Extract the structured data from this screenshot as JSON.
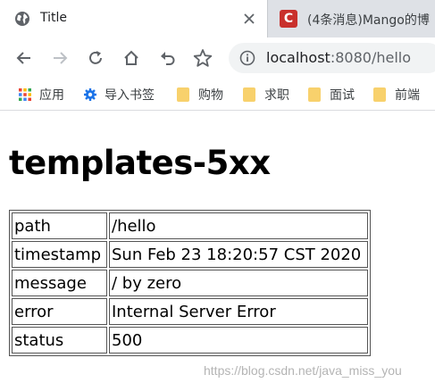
{
  "browser": {
    "active_tab": {
      "title": "Title",
      "icon": "globe-icon"
    },
    "inactive_tab": {
      "title": "(4条消息)Mango的博",
      "icon": "csdn-icon",
      "icon_letter": "C"
    },
    "address": {
      "host": "localhost",
      "rest": ":8080/hello"
    },
    "bookmarks": [
      {
        "label": "应用",
        "icon": "apps-grid-icon"
      },
      {
        "label": "导入书签",
        "icon": "gear-icon"
      },
      {
        "label": "购物",
        "icon": "folder-icon"
      },
      {
        "label": "求职",
        "icon": "folder-icon"
      },
      {
        "label": "面试",
        "icon": "folder-icon"
      },
      {
        "label": "前端",
        "icon": "folder-icon"
      }
    ]
  },
  "page": {
    "heading": "templates-5xx",
    "rows": [
      {
        "key": "path",
        "value": "/hello"
      },
      {
        "key": "timestamp",
        "value": "Sun Feb 23 18:20:57 CST 2020"
      },
      {
        "key": "message",
        "value": "/ by zero"
      },
      {
        "key": "error",
        "value": "Internal Server Error"
      },
      {
        "key": "status",
        "value": "500"
      }
    ],
    "watermark": "https://blog.csdn.net/java_miss_you"
  },
  "colors": {
    "tabstrip": "#dee1e6",
    "omnibox": "#f1f3f4",
    "folder": "#f8d16c",
    "csdn": "#c9302c"
  }
}
